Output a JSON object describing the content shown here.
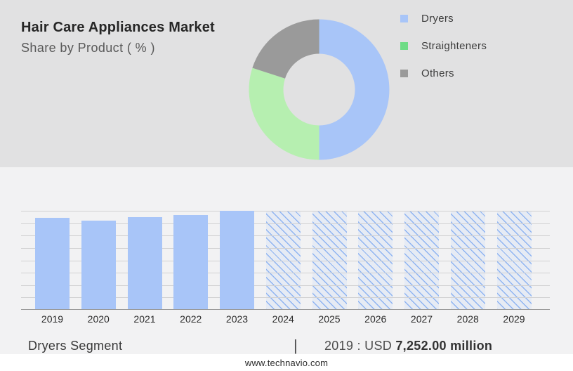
{
  "header": {
    "title": "Hair Care Appliances Market",
    "subtitle": "Share by Product ( % )"
  },
  "colors": {
    "top_section_bg": "#e1e1e2",
    "chart_section_bg": "#f2f2f3",
    "dryers_blue": "#a8c5f8",
    "donut_green": "#b6efb0",
    "legend_green": "#6edc86",
    "others_gray": "#9a9a9a",
    "gridline_gray": "#d1d1d2",
    "axis_gray": "#9a9a9a",
    "hatch_line_blue": "#8fb4f2"
  },
  "legend": {
    "items": [
      {
        "label": "Dryers",
        "color": "#a8c5f8"
      },
      {
        "label": "Straighteners",
        "color": "#6edc86"
      },
      {
        "label": "Others",
        "color": "#9a9a9a"
      }
    ]
  },
  "chart_data": [
    {
      "type": "pie",
      "donut": true,
      "title": "Hair Care Appliances Market - Share by Product ( % )",
      "labels": [
        "Dryers",
        "Straighteners",
        "Others"
      ],
      "values": [
        50,
        30,
        20
      ],
      "colors": [
        "#a8c5f8",
        "#b6efb0",
        "#9a9a9a"
      ],
      "start_angle_deg_from_top": 0,
      "direction": "clockwise",
      "inner_radius_ratio": 0.51,
      "legend_position": "right"
    },
    {
      "type": "bar",
      "categories": [
        "2019",
        "2020",
        "2021",
        "2022",
        "2023",
        "2024",
        "2025",
        "2026",
        "2027",
        "2028",
        "2029"
      ],
      "series": [
        {
          "name": "Dryers segment market size (relative bar height, % of 2023 peak)",
          "values": [
            93,
            90,
            93.5,
            96,
            100,
            100,
            100,
            100,
            100,
            100,
            100
          ]
        }
      ],
      "solid_years": [
        "2019",
        "2020",
        "2021",
        "2022",
        "2023"
      ],
      "hatched_forecast_years": [
        "2024",
        "2025",
        "2026",
        "2027",
        "2028",
        "2029"
      ],
      "known_point": {
        "year": "2019",
        "value": "USD 7,252.00 million"
      },
      "xlabel": "",
      "ylabel": "",
      "y_axis_labels_shown": false,
      "gridlines": 9,
      "grid": "horizontal",
      "bar_color": "#a8c5f8"
    }
  ],
  "footer": {
    "segment_label": "Dryers Segment",
    "separator": "|",
    "value_plain": "2019 : USD ",
    "value_bold": "7,252.00 million",
    "website": "www.technavio.com"
  }
}
